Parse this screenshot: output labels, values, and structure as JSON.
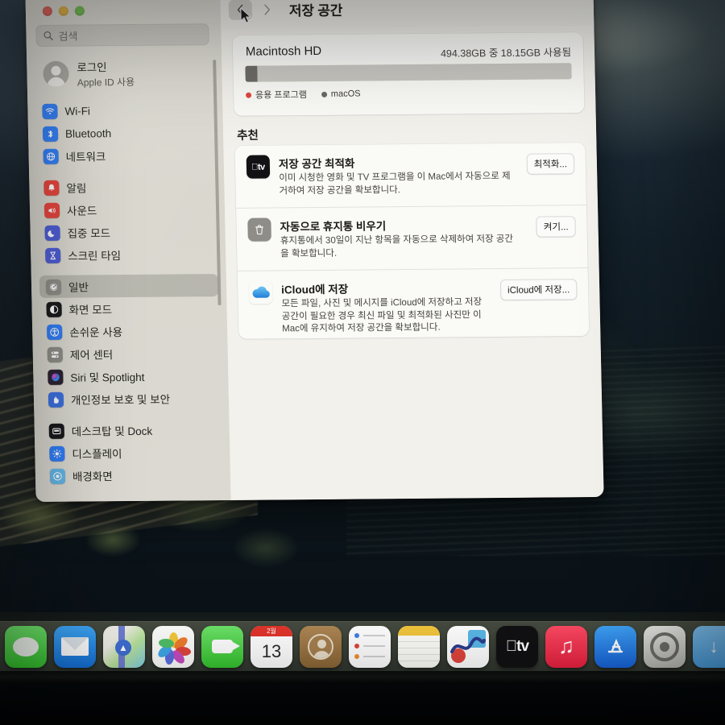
{
  "window": {
    "traffic_lights": [
      "close",
      "minimize",
      "maximize"
    ],
    "page_title": "저장 공간"
  },
  "search": {
    "placeholder": "검색",
    "icon": "search-icon"
  },
  "account": {
    "title": "로그인",
    "subtitle": "Apple ID 사용",
    "icon": "avatar-icon"
  },
  "sidebar": {
    "groups": [
      {
        "items": [
          {
            "label": "Wi-Fi",
            "icon": "wifi-icon",
            "color": "#2f7cf6",
            "selected": false
          },
          {
            "label": "Bluetooth",
            "icon": "bluetooth-icon",
            "color": "#2f7cf6",
            "selected": false
          },
          {
            "label": "네트워크",
            "icon": "network-globe-icon",
            "color": "#2f7cf6",
            "selected": false
          }
        ]
      },
      {
        "items": [
          {
            "label": "알림",
            "icon": "bell-icon",
            "color": "#e8413a",
            "selected": false
          },
          {
            "label": "사운드",
            "icon": "speaker-icon",
            "color": "#e8413a",
            "selected": false
          },
          {
            "label": "집중 모드",
            "icon": "moon-icon",
            "color": "#4b5bd6",
            "selected": false
          },
          {
            "label": "스크린 타임",
            "icon": "hourglass-icon",
            "color": "#4b5bd6",
            "selected": false
          }
        ]
      },
      {
        "items": [
          {
            "label": "일반",
            "icon": "gear-icon",
            "color": "#8e8d87",
            "selected": true
          },
          {
            "label": "화면 모드",
            "icon": "appearance-icon",
            "color": "#17171a",
            "selected": false
          },
          {
            "label": "손쉬운 사용",
            "icon": "accessibility-icon",
            "color": "#2f7cf6",
            "selected": false
          },
          {
            "label": "제어 센터",
            "icon": "control-center-icon",
            "color": "#8e8d87",
            "selected": false
          },
          {
            "label": "Siri 및 Spotlight",
            "icon": "siri-icon",
            "color": "#2a2030",
            "selected": false
          },
          {
            "label": "개인정보 보호 및 보안",
            "icon": "privacy-hand-icon",
            "color": "#3b6fe0",
            "selected": false
          }
        ]
      },
      {
        "items": [
          {
            "label": "데스크탑 및 Dock",
            "icon": "desktop-dock-icon",
            "color": "#17171a",
            "selected": false
          },
          {
            "label": "디스플레이",
            "icon": "display-brightness-icon",
            "color": "#2f7cf6",
            "selected": false
          },
          {
            "label": "배경화면",
            "icon": "wallpaper-icon",
            "color": "#63b6e8",
            "selected": false
          }
        ]
      }
    ]
  },
  "toolbar": {
    "back_icon": "chevron-left-icon",
    "forward_icon": "chevron-right-icon"
  },
  "storage": {
    "volume_name": "Macintosh HD",
    "usage_text": "494.38GB 중 18.15GB 사용됨",
    "total_gb": 494.38,
    "used_gb": 18.15,
    "segments": [
      {
        "name": "macOS",
        "color": "#6b6a66",
        "percent": 3.7
      },
      {
        "name": "free",
        "color": "#c9c8c2",
        "percent": 96.3
      }
    ],
    "legend": [
      {
        "label": "응용 프로그램",
        "color": "#e0453d"
      },
      {
        "label": "macOS",
        "color": "#6b6a66"
      }
    ]
  },
  "recommendations": {
    "heading": "추천",
    "items": [
      {
        "icon": "apple-tv-icon",
        "title": "저장 공간 최적화",
        "description": "이미 시청한 영화 및 TV 프로그램을 이 Mac에서 자동으로 제거하여 저장 공간을 확보합니다.",
        "button": "최적화..."
      },
      {
        "icon": "trash-icon",
        "title": "자동으로 휴지통 비우기",
        "description": "휴지통에서 30일이 지난 항목을 자동으로 삭제하여 저장 공간을 확보합니다.",
        "button": "켜기..."
      },
      {
        "icon": "icloud-icon",
        "title": "iCloud에 저장",
        "description": "모든 파일, 사진 및 메시지를 iCloud에 저장하고 저장 공간이 필요한 경우 최신 파일 및 최적화된 사진만 이 Mac에 유지하여 저장 공간을 확보합니다.",
        "button": "iCloud에 저장..."
      }
    ]
  },
  "dock": {
    "items": [
      {
        "name": "messages-icon",
        "label": "메시지"
      },
      {
        "name": "mail-icon",
        "label": "메일"
      },
      {
        "name": "maps-icon",
        "label": "지도"
      },
      {
        "name": "photos-icon",
        "label": "사진"
      },
      {
        "name": "facetime-icon",
        "label": "FaceTime"
      },
      {
        "name": "calendar-icon",
        "label": "캘린더",
        "month": "2월",
        "day": "13"
      },
      {
        "name": "contacts-icon",
        "label": "연락처"
      },
      {
        "name": "reminders-icon",
        "label": "미리 알림"
      },
      {
        "name": "notes-icon",
        "label": "메모"
      },
      {
        "name": "freeform-icon",
        "label": "프리폼"
      },
      {
        "name": "apple-tv-dock-icon",
        "label": "Apple TV"
      },
      {
        "name": "music-icon",
        "label": "음악"
      },
      {
        "name": "app-store-icon",
        "label": "App Store"
      },
      {
        "name": "system-settings-icon",
        "label": "시스템 설정"
      },
      {
        "name": "downloads-folder-icon",
        "label": "다운로드"
      }
    ]
  }
}
